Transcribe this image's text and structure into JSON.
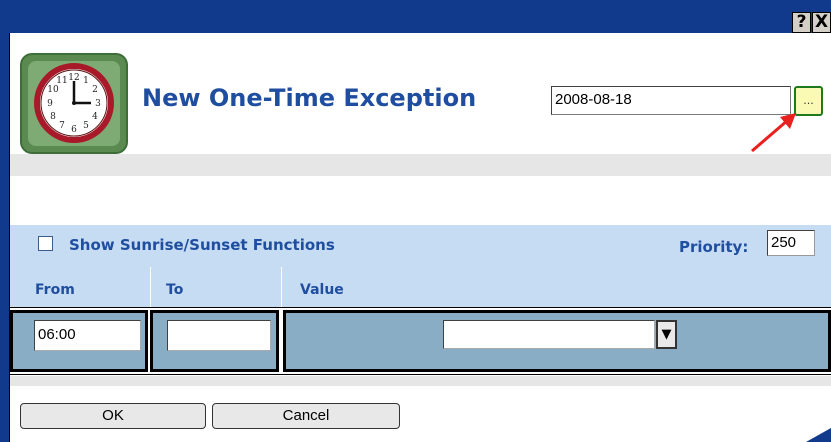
{
  "titlebar": {
    "help_label": "?",
    "close_label": "X"
  },
  "header": {
    "title": "New One-Time Exception",
    "clock_icon": "clock-icon"
  },
  "date": {
    "value": "2008-08-18",
    "picker_label": "..."
  },
  "options": {
    "sunrise_label": "Show Sunrise/Sunset Functions",
    "sunrise_checked": false,
    "priority_label": "Priority:",
    "priority_value": "250"
  },
  "table": {
    "columns": [
      "From",
      "To",
      "Value"
    ],
    "row": {
      "from": "06:00",
      "to": "",
      "value": ""
    }
  },
  "footer": {
    "ok_label": "OK",
    "cancel_label": "Cancel"
  },
  "colors": {
    "titlebar": "#123a8c",
    "heading": "#1f4ea0",
    "header_bg": "#c6dcf3",
    "cell_bg": "#89adc4",
    "annotation_arrow": "#e8201e"
  }
}
